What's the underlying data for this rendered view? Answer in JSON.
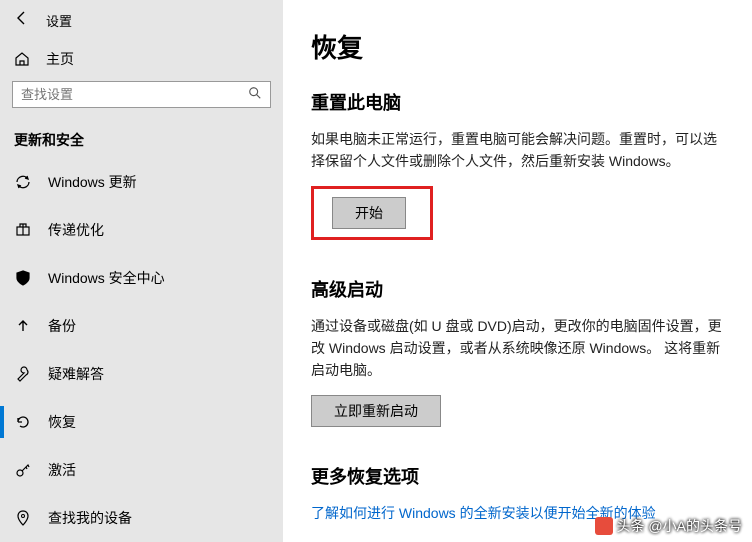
{
  "header": {
    "title": "设置"
  },
  "home": {
    "label": "主页"
  },
  "search": {
    "placeholder": "查找设置"
  },
  "category": {
    "label": "更新和安全"
  },
  "nav": {
    "items": [
      {
        "id": "windows-update",
        "label": "Windows 更新"
      },
      {
        "id": "delivery-optimization",
        "label": "传递优化"
      },
      {
        "id": "windows-security",
        "label": "Windows 安全中心"
      },
      {
        "id": "backup",
        "label": "备份"
      },
      {
        "id": "troubleshoot",
        "label": "疑难解答"
      },
      {
        "id": "recovery",
        "label": "恢复"
      },
      {
        "id": "activation",
        "label": "激活"
      },
      {
        "id": "find-my-device",
        "label": "查找我的设备"
      }
    ]
  },
  "main": {
    "title": "恢复",
    "reset": {
      "heading": "重置此电脑",
      "desc": "如果电脑未正常运行，重置电脑可能会解决问题。重置时，可以选择保留个人文件或删除个人文件，然后重新安装 Windows。",
      "button": "开始"
    },
    "advanced": {
      "heading": "高级启动",
      "desc": "通过设备或磁盘(如 U 盘或 DVD)启动，更改你的电脑固件设置，更改 Windows 启动设置，或者从系统映像还原 Windows。 这将重新启动电脑。",
      "button": "立即重新启动"
    },
    "more": {
      "heading": "更多恢复选项",
      "link": "了解如何进行 Windows 的全新安装以便开始全新的体验"
    }
  },
  "watermark": {
    "text": "头条 @小A的头条号"
  }
}
